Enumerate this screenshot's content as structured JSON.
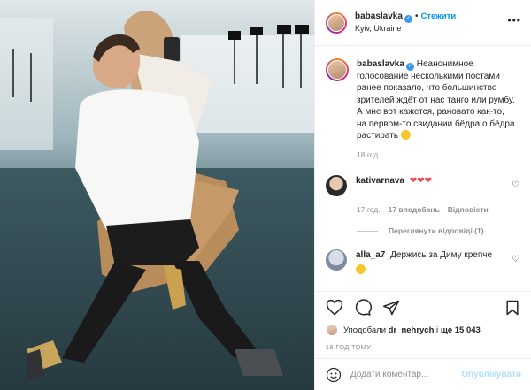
{
  "header": {
    "username": "babaslavka",
    "follow_label": "Стежити",
    "location": "Kyiv, Ukraine"
  },
  "caption": {
    "username": "babaslavka",
    "text": "Неанонимное голосование несколькими постами ранее показало, что большинство зрителей ждёт от нас танго или румбу.\nА мне вот кажется, рановато как-то, на первом-то свидании бёдра о бёдра растирать",
    "time": "18 год."
  },
  "comments": [
    {
      "username": "kativarnava",
      "text": "❤❤❤",
      "time": "17 год.",
      "likes": "17 вподобань",
      "reply": "Відповісти",
      "view_replies": "Переглянути відповіді (1)"
    },
    {
      "username": "alla_a7",
      "text": "Держись за Диму крепче"
    }
  ],
  "likes": {
    "prefix": "Уподобали",
    "user": "dr_nehrych",
    "and": "і",
    "count": "ще 15 043"
  },
  "time_ago": "18 ГОД ТОМУ",
  "add_comment": {
    "placeholder": "Додати коментар...",
    "publish": "Опублікувати"
  },
  "colors": {
    "accent": "#0095f6",
    "heart": "#ed4956",
    "muted": "#8e8e8e"
  },
  "icons": [
    "more-icon",
    "heart-icon",
    "comment-icon",
    "share-icon",
    "bookmark-icon",
    "smile-icon",
    "verified-icon"
  ]
}
